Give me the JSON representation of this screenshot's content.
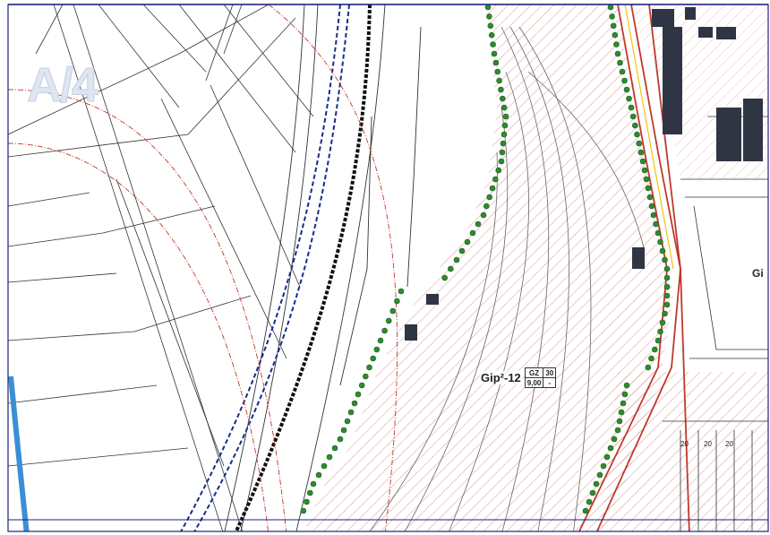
{
  "map": {
    "sheet_label": "A/4",
    "zone": {
      "code": "Gip²-12",
      "table": {
        "r1c1": "GZ",
        "r1c2": "30",
        "r2c1": "9,00",
        "r2c2": "-"
      }
    },
    "edge_label": "Gi",
    "dimension_labels": [
      "20",
      "20",
      "20"
    ],
    "colors": {
      "parcel_line": "#333333",
      "plan_red": "#c0392b",
      "hatch": "#d97a7a",
      "blue_boundary": "#1a2b8a",
      "tree_fill": "#2e8b2e",
      "water": "#3a8fd6",
      "frame": "#1a237e"
    }
  }
}
